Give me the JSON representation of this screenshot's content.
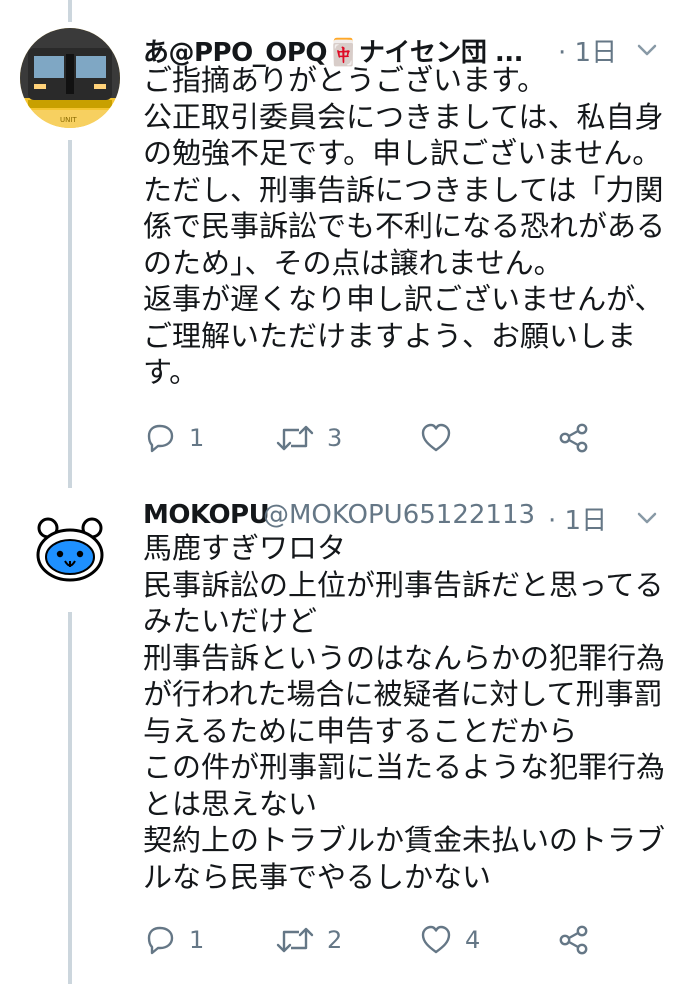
{
  "tweets": [
    {
      "display_name": "あ@PPO_OPQ🀄ナイセン団 ...",
      "time": "· 1日",
      "lines": [
        "ご指摘ありがとうございます。",
        "公正取引委員会につきましては、私自身",
        "の勉強不足です。申し訳ございません。",
        "ただし、刑事告訴につきましては「力関",
        "係で民事訴訟でも不利になる恐れがある",
        "のため」、その点は譲れません。",
        "返事が遅くなり申し訳ございませんが、",
        "ご理解いただけますよう、お願いしま",
        "す。"
      ],
      "reply_count": "1",
      "retweet_count": "3",
      "like_count": "",
      "avatar_icon": "train-avatar-icon"
    },
    {
      "display_name": "MOKOPU",
      "handle": "@MOKOPU65122113",
      "time": "· 1日",
      "lines": [
        "馬鹿すぎワロタ",
        "民事訴訟の上位が刑事告訴だと思ってる",
        "みたいだけど",
        "刑事告訴というのはなんらかの犯罪行為",
        "が行われた場合に被疑者に対して刑事罰",
        "与えるために申告することだから",
        "この件が刑事罰に当たるような犯罪行為",
        "とは思えない",
        "契約上のトラブルか賃金未払いのトラブ",
        "ルなら民事でやるしかない"
      ],
      "reply_count": "1",
      "retweet_count": "2",
      "like_count": "4",
      "avatar_icon": "bear-avatar-icon"
    }
  ],
  "colors": {
    "text": "#14171a",
    "secondary": "#657786",
    "thread_line": "#ccd6dd",
    "avatar_yellow": "#f4c430",
    "bear_blue": "#1e90ff"
  },
  "icons": [
    "reply-icon",
    "retweet-icon",
    "like-icon",
    "share-icon",
    "chevron-down-icon"
  ]
}
